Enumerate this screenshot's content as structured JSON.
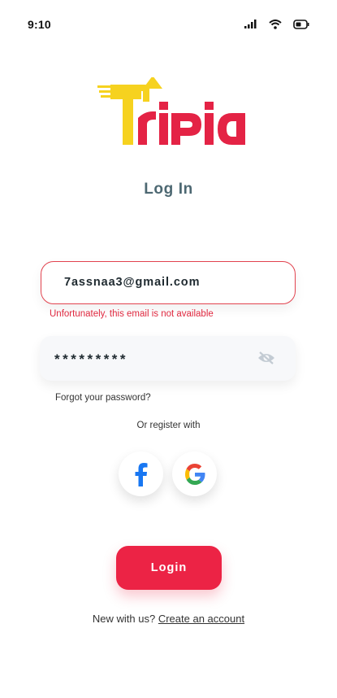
{
  "status_bar": {
    "time": "9:10",
    "icons": [
      "signal-icon",
      "wifi-icon",
      "battery-icon"
    ]
  },
  "brand": {
    "logo_text": "TriPia",
    "colors": {
      "yellow": "#f6d21f",
      "red": "#e42345"
    }
  },
  "page": {
    "title": "Log In"
  },
  "form": {
    "email": {
      "value": "7assnaa3@gmail.com",
      "error": "Unfortunately, this email is not available"
    },
    "password": {
      "value": "*********",
      "toggle_icon": "eye-off-icon"
    },
    "forgot_password": "Forgot your password?"
  },
  "social": {
    "label": "Or register with",
    "providers": [
      "facebook-icon",
      "google-icon"
    ]
  },
  "actions": {
    "login_label": "Login"
  },
  "signup": {
    "prompt": "New with us?",
    "link": "Create an account"
  },
  "colors": {
    "accent": "#ec2345",
    "error": "#e0283f",
    "title": "#4d6872",
    "facebook": "#1877f2"
  }
}
